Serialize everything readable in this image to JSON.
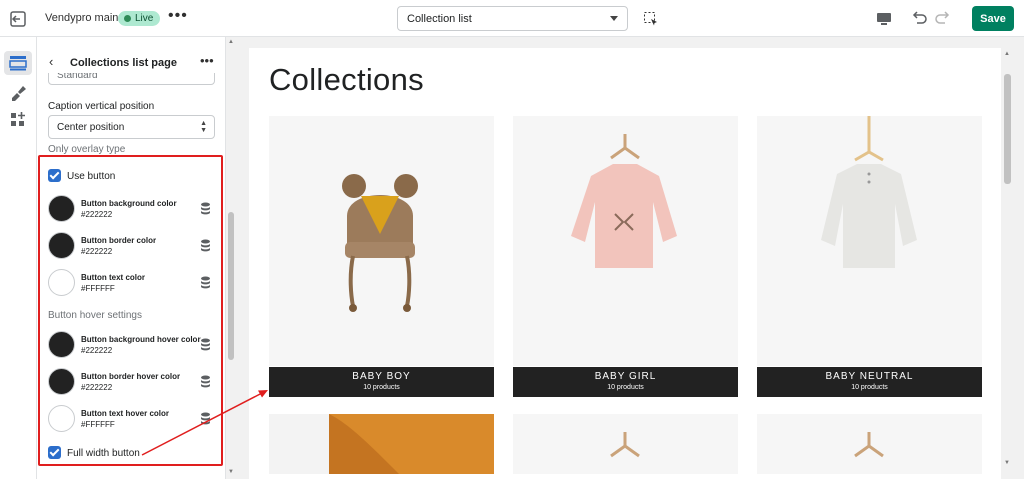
{
  "topbar": {
    "store_name": "Vendypro main",
    "status_badge": "Live",
    "more": "•••",
    "page_select": "Collection list",
    "save_label": "Save"
  },
  "panel": {
    "back": "‹",
    "title": "Collections list page",
    "more": "•••",
    "field_top_value": "Standard",
    "caption_label": "Caption vertical position",
    "caption_value": "Center position",
    "caption_help": "Only overlay type",
    "use_button_label": "Use button",
    "colors": [
      {
        "label": "Button background color",
        "value": "#222222",
        "swatch": "#222222"
      },
      {
        "label": "Button border color",
        "value": "#222222",
        "swatch": "#222222"
      },
      {
        "label": "Button text color",
        "value": "#FFFFFF",
        "swatch": "#FFFFFF"
      }
    ],
    "hover_heading": "Button hover settings",
    "hover_colors": [
      {
        "label": "Button background hover color",
        "value": "#222222",
        "swatch": "#222222"
      },
      {
        "label": "Button border hover color",
        "value": "#222222",
        "swatch": "#222222"
      },
      {
        "label": "Button text hover color",
        "value": "#FFFFFF",
        "swatch": "#FFFFFF"
      }
    ],
    "full_width_label": "Full width button"
  },
  "canvas": {
    "title": "Collections",
    "collections": [
      {
        "name": "BABY BOY",
        "count": "10 products"
      },
      {
        "name": "BABY GIRL",
        "count": "10 products"
      },
      {
        "name": "BABY NEUTRAL",
        "count": "10 products"
      }
    ]
  },
  "colors": {
    "primary": "#008060",
    "annotation": "#e01e1e",
    "checkbox": "#2c6ecb"
  }
}
